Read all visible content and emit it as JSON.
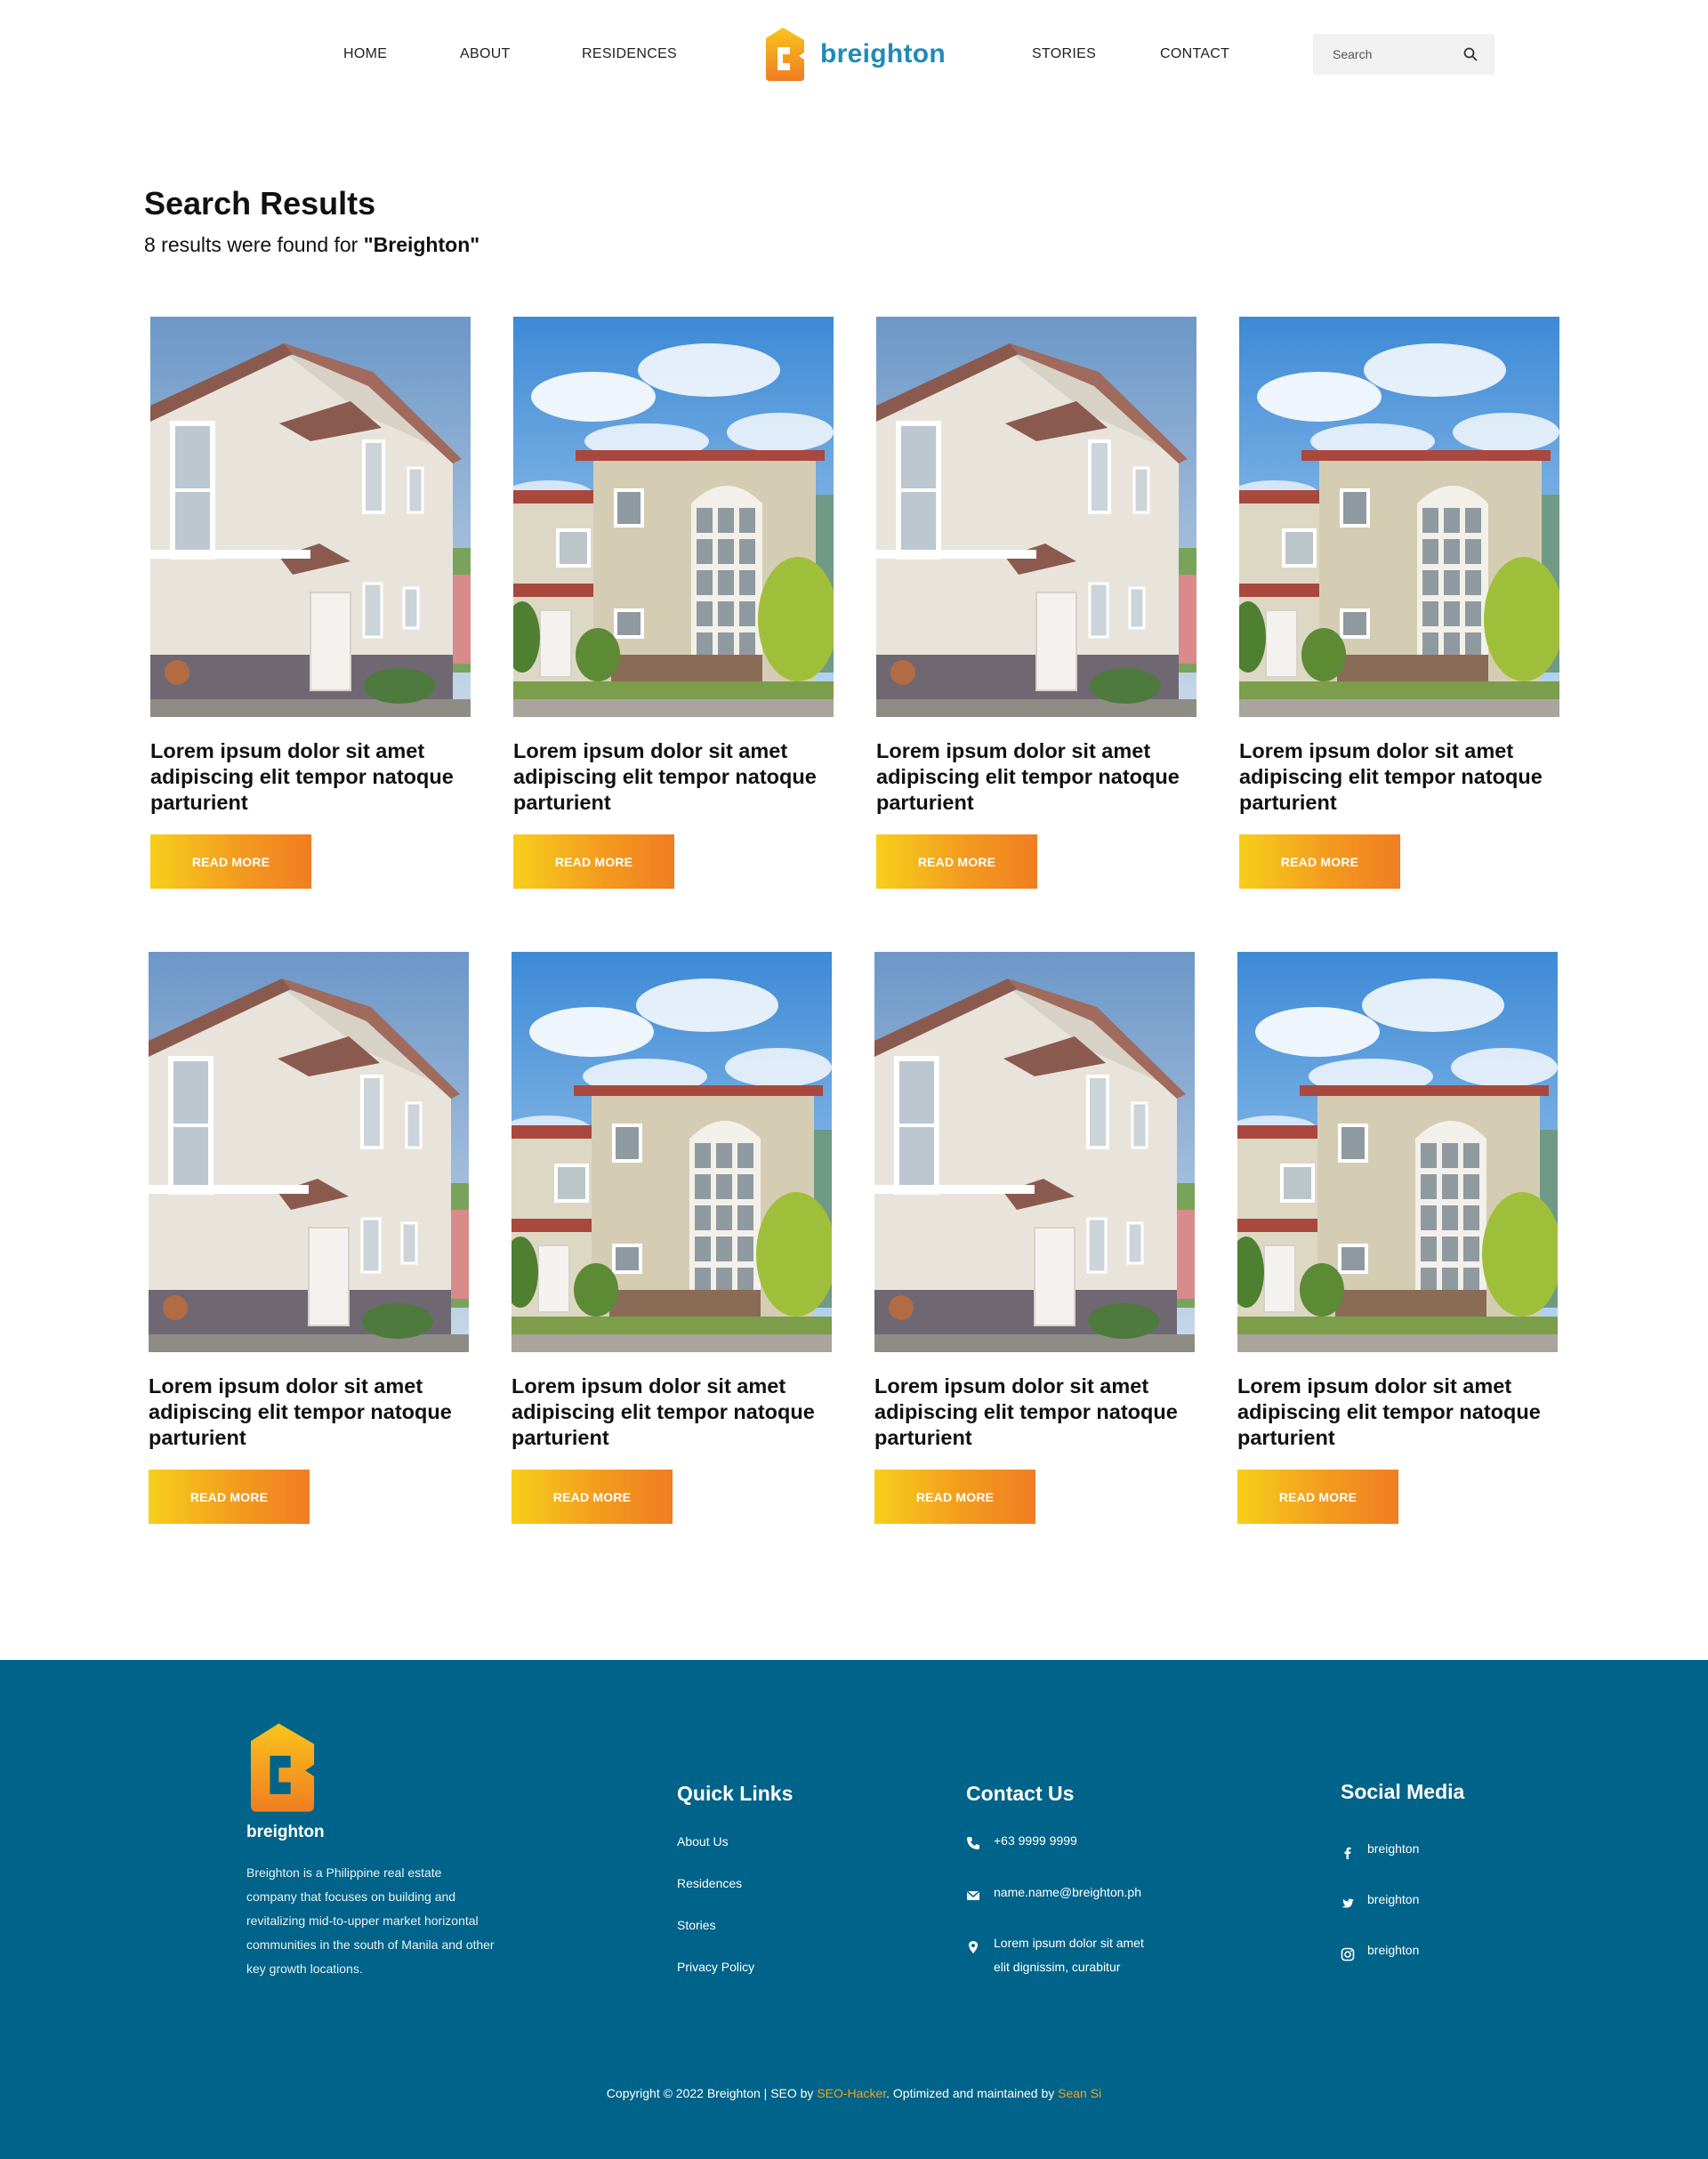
{
  "nav": {
    "home": "HOME",
    "about": "ABOUT",
    "residences": "RESIDENCES",
    "stories": "STORIES",
    "contact": "CONTACT"
  },
  "brand": {
    "name": "breighton",
    "primary_color": "#1f8bb8",
    "accent_color": "#f39b1e"
  },
  "search": {
    "placeholder": "Search",
    "icon": "search-icon"
  },
  "results": {
    "title": "Search Results",
    "count_prefix": "8 results were found for ",
    "query": "\"Breighton\""
  },
  "cards": [
    {
      "image": "house-side-view",
      "title": "Lorem ipsum dolor sit amet adipiscing elit tempor natoque parturient",
      "button": "READ MORE"
    },
    {
      "image": "house-front-view",
      "title": "Lorem ipsum dolor sit amet adipiscing elit tempor natoque parturient",
      "button": "READ MORE"
    },
    {
      "image": "house-side-view",
      "title": "Lorem ipsum dolor sit amet adipiscing elit tempor natoque parturient",
      "button": "READ MORE"
    },
    {
      "image": "house-front-view",
      "title": "Lorem ipsum dolor sit amet adipiscing elit tempor natoque parturient",
      "button": "READ MORE"
    },
    {
      "image": "house-side-view",
      "title": "Lorem ipsum dolor sit amet adipiscing elit tempor natoque parturient",
      "button": "READ MORE"
    },
    {
      "image": "house-front-view",
      "title": "Lorem ipsum dolor sit amet adipiscing elit tempor natoque parturient",
      "button": "READ MORE"
    },
    {
      "image": "house-side-view",
      "title": "Lorem ipsum dolor sit amet adipiscing elit tempor natoque parturient",
      "button": "READ MORE"
    },
    {
      "image": "house-front-view",
      "title": "Lorem ipsum dolor sit amet adipiscing elit tempor natoque parturient",
      "button": "READ MORE"
    }
  ],
  "footer": {
    "background": "#006389",
    "brand_name": "breighton",
    "about": "Breighton is a Philippine real estate company that focuses on building  and revitalizing mid-to-upper  market horizontal communities in  the south of Manila and other key  growth locations.",
    "quick_links": {
      "heading": "Quick Links",
      "items": [
        "About Us",
        "Residences",
        "Stories",
        "Privacy Policy"
      ]
    },
    "contact": {
      "heading": "Contact Us",
      "phone": "+63 9999 9999",
      "email": "name.name@breighton.ph",
      "address_line1": "Lorem ipsum dolor sit amet",
      "address_line2": "elit dignissim, curabitur"
    },
    "social": {
      "heading": "Social Media",
      "facebook": "breighton",
      "twitter": "breighton",
      "instagram": "breighton"
    },
    "copyright": {
      "prefix": "Copyright © 2022 Breighton | SEO by ",
      "seo_link": "SEO-Hacker",
      "middle": ". Optimized and maintained by ",
      "maintainer_link": "Sean Si"
    }
  }
}
